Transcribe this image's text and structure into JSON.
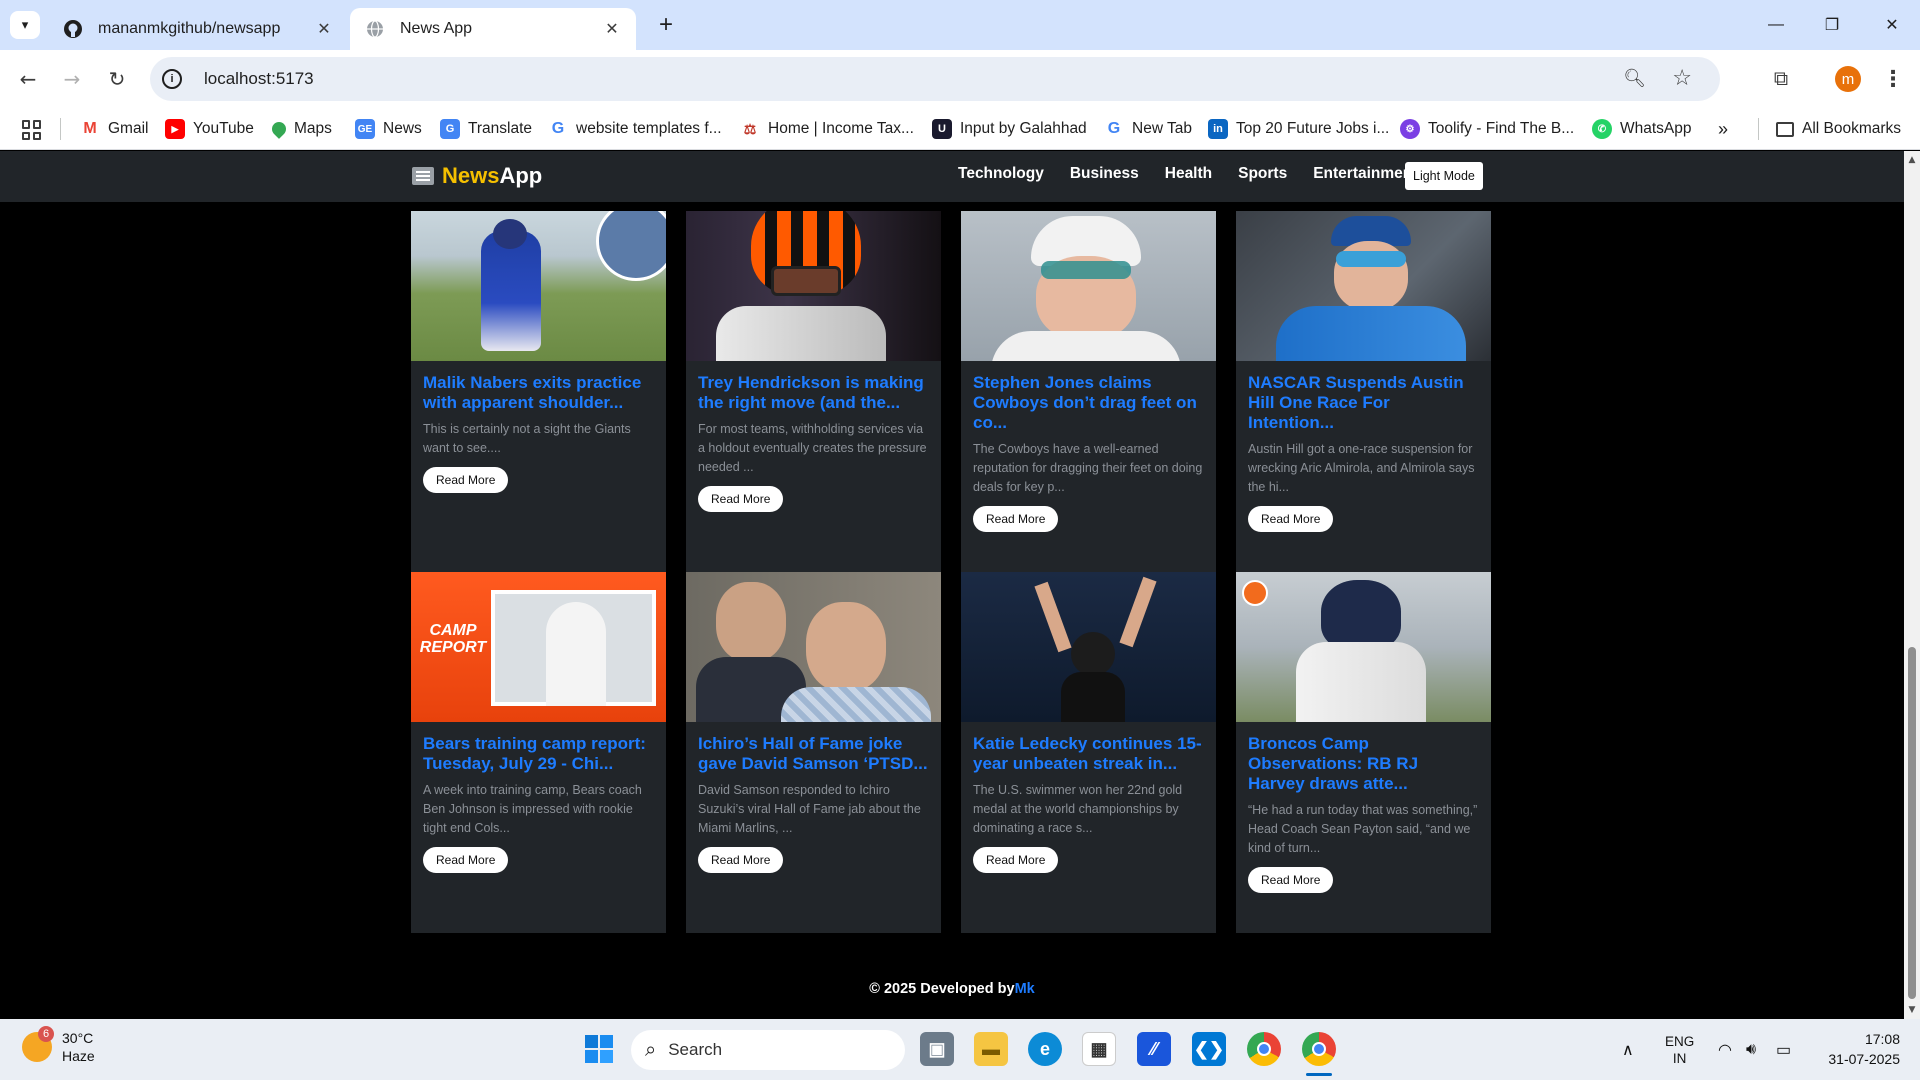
{
  "browser": {
    "tabs": [
      {
        "title": "mananmkgithub/newsapp",
        "icon": "github-icon"
      },
      {
        "title": "News App",
        "icon": "globe-icon",
        "active": true
      }
    ],
    "url": "localhost:5173",
    "profile_initial": "m",
    "bookmarks": [
      {
        "label": "Gmail",
        "icon": "gmail-icon",
        "color": "#ea4335"
      },
      {
        "label": "YouTube",
        "icon": "youtube-icon",
        "color": "#ff0000"
      },
      {
        "label": "Maps",
        "icon": "maps-icon",
        "color": "#34a853"
      },
      {
        "label": "News",
        "icon": "google-news-icon",
        "color": "#4285f4"
      },
      {
        "label": "Translate",
        "icon": "translate-icon",
        "color": "#4285f4"
      },
      {
        "label": "website templates f...",
        "icon": "google-icon",
        "color": "#4285f4"
      },
      {
        "label": "Home | Income Tax...",
        "icon": "income-tax-icon",
        "color": "#c0392b"
      },
      {
        "label": "Input by Galahhad",
        "icon": "galahhad-icon",
        "color": "#222222"
      },
      {
        "label": "New Tab",
        "icon": "google-icon",
        "color": "#4285f4"
      },
      {
        "label": "Top 20 Future Jobs i...",
        "icon": "linkedin-icon",
        "color": "#0a66c2"
      },
      {
        "label": "Toolify - Find The B...",
        "icon": "toolify-icon",
        "color": "#7b3fe4"
      },
      {
        "label": "WhatsApp",
        "icon": "whatsapp-icon",
        "color": "#25d366"
      }
    ],
    "all_bookmarks": "All Bookmarks"
  },
  "app": {
    "brand_news": "News",
    "brand_app": "App",
    "nav": [
      "Technology",
      "Business",
      "Health",
      "Sports",
      "Entertainment"
    ],
    "mode_button": "Light Mode",
    "read_more": "Read More",
    "articles": [
      {
        "title": "Malik Nabers exits practice with apparent shoulder...",
        "desc": "This is certainly not a sight the Giants want to see...."
      },
      {
        "title": "Trey Hendrickson is making the right move (and the...",
        "desc": "For most teams, withholding services via a holdout eventually creates the pressure needed ..."
      },
      {
        "title": "Stephen Jones claims Cowboys don’t drag feet on co...",
        "desc": "The Cowboys have a well-earned reputation for dragging their feet on doing deals for key p..."
      },
      {
        "title": "NASCAR Suspends Austin Hill One Race For Intention...",
        "desc": "Austin Hill got a one-race suspension for wrecking Aric Almirola, and Almirola says the hi..."
      },
      {
        "title": "Bears training camp report: Tuesday, July 29 - Chi...",
        "desc": "A week into training camp, Bears coach Ben Johnson is impressed with rookie tight end Cols..."
      },
      {
        "title": "Ichiro’s Hall of Fame joke gave David Samson ‘PTSD...",
        "desc": "David Samson responded to Ichiro Suzuki’s viral Hall of Fame jab about the Miami Marlins, ..."
      },
      {
        "title": "Katie Ledecky continues 15-year unbeaten streak in...",
        "desc": "The U.S. swimmer won her 22nd gold medal at the world championships by dominating a race s..."
      },
      {
        "title": "Broncos Camp Observations: RB RJ Harvey draws atte...",
        "desc": "“He had a run today that was something,” Head Coach Sean Payton said, “and we kind of turn..."
      }
    ],
    "camp_report_text": "CAMP REPORT",
    "footer_prefix": "© 2025 Developed by",
    "footer_link": "Mk"
  },
  "taskbar": {
    "temp": "30°C",
    "condition": "Haze",
    "weather_badge": "6",
    "search_placeholder": "Search",
    "lang_1": "ENG",
    "lang_2": "IN",
    "time": "17:08",
    "date": "31-07-2025"
  }
}
